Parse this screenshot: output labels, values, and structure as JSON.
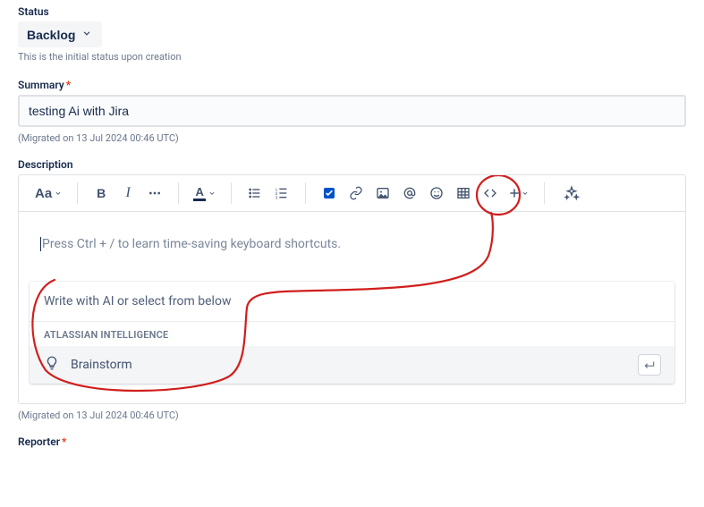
{
  "status": {
    "label": "Status",
    "value": "Backlog",
    "helper": "This is the initial status upon creation"
  },
  "summary": {
    "label": "Summary",
    "required_marker": "*",
    "value": "testing Ai with Jira"
  },
  "migrated_text": "(Migrated on 13 Jul 2024 00:46 UTC)",
  "description": {
    "label": "Description",
    "placeholder": "Press Ctrl + / to learn time-saving keyboard shortcuts."
  },
  "toolbar": {
    "text_styles": "Aa"
  },
  "ai": {
    "prompt_placeholder": "Write with AI or select from below",
    "section_label": "ATLASSIAN INTELLIGENCE",
    "option_brainstorm": "Brainstorm"
  },
  "reporter": {
    "label": "Reporter",
    "required_marker": "*"
  }
}
